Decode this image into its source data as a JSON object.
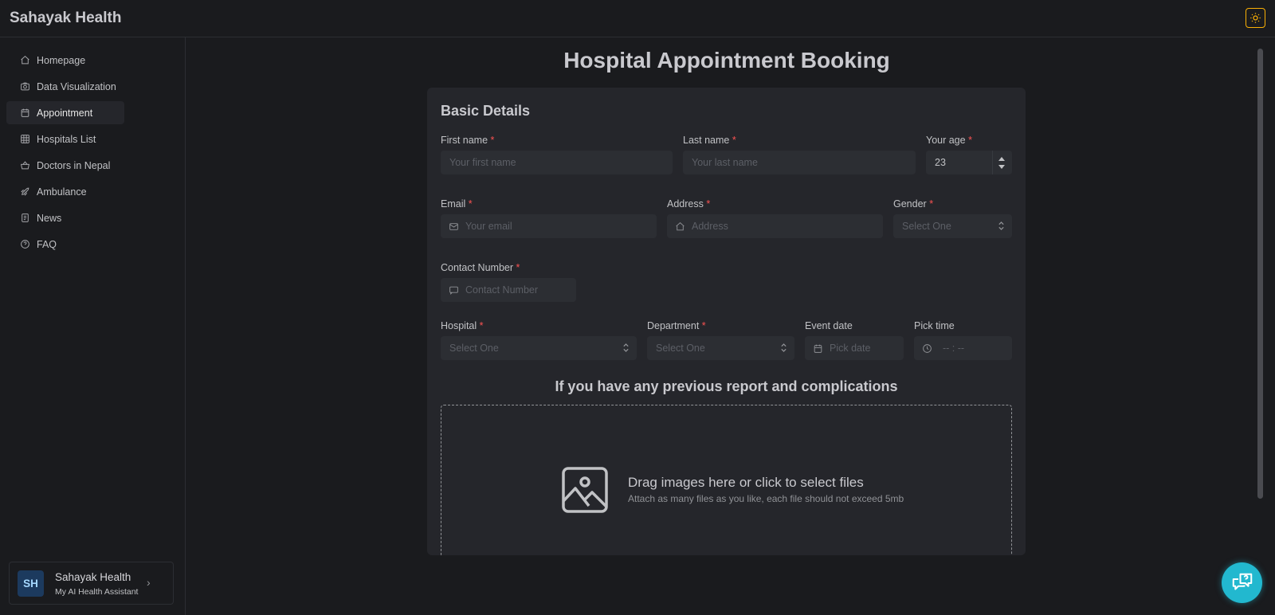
{
  "app": {
    "title": "Sahayak Health"
  },
  "colors": {
    "accent": "#22b8cf",
    "theme_toggle": "#fab005",
    "required": "#fa5252"
  },
  "sidebar": {
    "items": [
      {
        "label": "Homepage",
        "icon": "home-icon",
        "active": false
      },
      {
        "label": "Data Visualization",
        "icon": "camera-icon",
        "active": false
      },
      {
        "label": "Appointment",
        "icon": "calendar-icon",
        "active": true
      },
      {
        "label": "Hospitals List",
        "icon": "table-icon",
        "active": false
      },
      {
        "label": "Doctors in Nepal",
        "icon": "basket-icon",
        "active": false
      },
      {
        "label": "Ambulance",
        "icon": "rocket-icon",
        "active": false
      },
      {
        "label": "News",
        "icon": "news-icon",
        "active": false
      },
      {
        "label": "FAQ",
        "icon": "help-icon",
        "active": false
      }
    ],
    "user": {
      "initials": "SH",
      "name": "Sahayak Health",
      "subtitle": "My AI Health Assistant"
    }
  },
  "main": {
    "page_title": "Hospital Appointment Booking",
    "section_title": "Basic Details",
    "fields": {
      "first_name": {
        "label": "First name",
        "required": "*",
        "placeholder": "Your first name"
      },
      "last_name": {
        "label": "Last name",
        "required": "*",
        "placeholder": "Your last name"
      },
      "age": {
        "label": "Your age",
        "required": "*",
        "value": "23"
      },
      "email": {
        "label": "Email",
        "required": "*",
        "placeholder": "Your email"
      },
      "address": {
        "label": "Address",
        "required": "*",
        "placeholder": "Address"
      },
      "gender": {
        "label": "Gender",
        "required": "*",
        "placeholder": "Select One"
      },
      "contact": {
        "label": "Contact Number",
        "required": "*",
        "placeholder": "Contact Number"
      },
      "hospital": {
        "label": "Hospital",
        "required": "*",
        "placeholder": "Select One"
      },
      "department": {
        "label": "Department",
        "required": "*",
        "placeholder": "Select One"
      },
      "event_date": {
        "label": "Event date",
        "placeholder": "Pick date"
      },
      "pick_time": {
        "label": "Pick time",
        "placeholder": "-- : --"
      }
    },
    "upload": {
      "title": "If you have any previous report and complications",
      "main_text": "Drag images here or click to select files",
      "sub_text": "Attach as many files as you like, each file should not exceed 5mb"
    }
  }
}
